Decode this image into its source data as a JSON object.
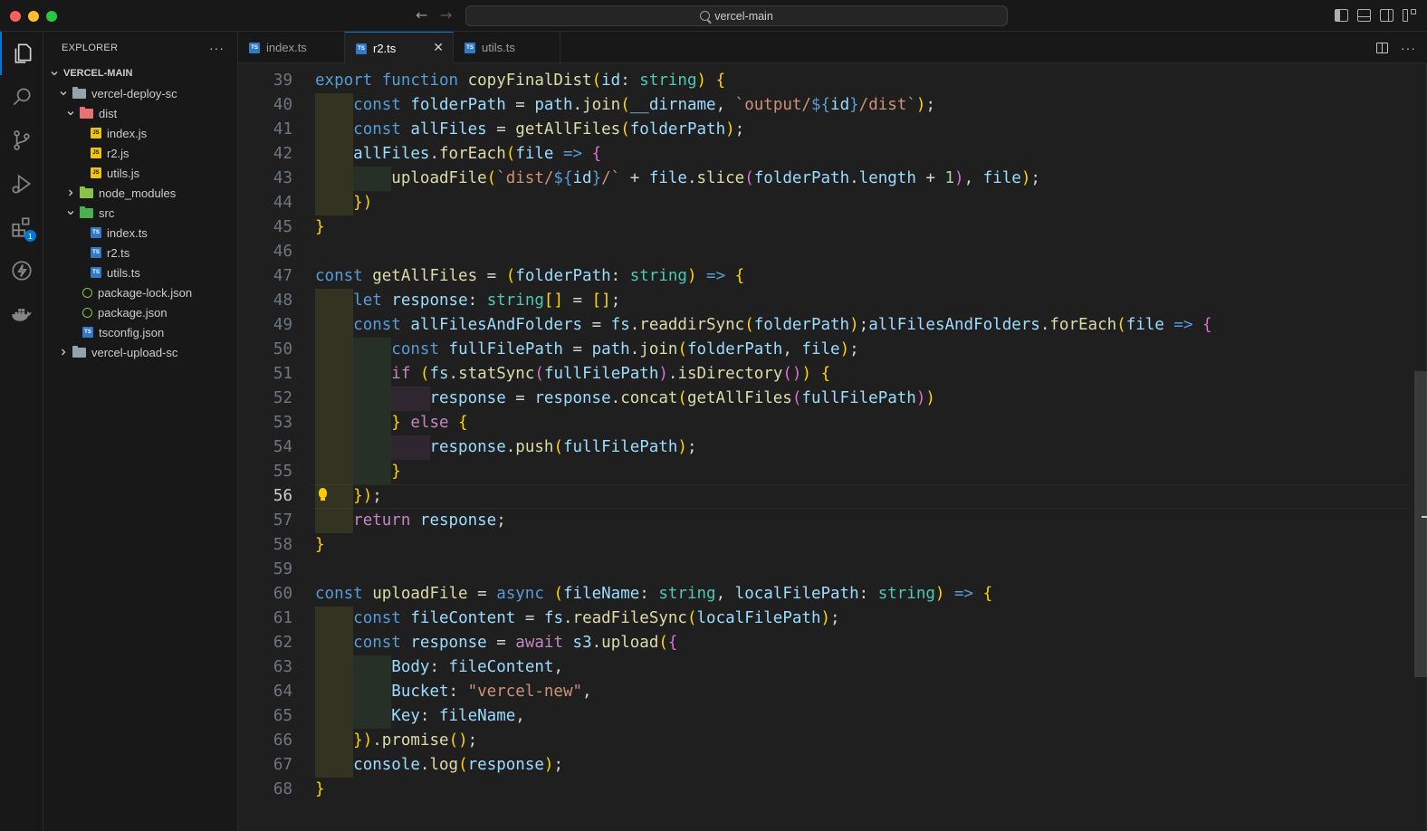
{
  "window": {
    "search_text": "vercel-main"
  },
  "sidebar": {
    "title": "EXPLORER",
    "more": "···",
    "root": "VERCEL-MAIN",
    "tree": [
      {
        "label": "vercel-deploy-sc",
        "kind": "folder-open",
        "icon": "folder-icon"
      },
      {
        "label": "dist",
        "kind": "folder-open",
        "icon": "folder-dist-icon"
      },
      {
        "label": "index.js",
        "kind": "file",
        "icon": "js-file-icon",
        "badge": "JS"
      },
      {
        "label": "r2.js",
        "kind": "file",
        "icon": "js-file-icon",
        "badge": "JS"
      },
      {
        "label": "utils.js",
        "kind": "file",
        "icon": "js-file-icon",
        "badge": "JS"
      },
      {
        "label": "node_modules",
        "kind": "folder-closed",
        "icon": "folder-node-icon"
      },
      {
        "label": "src",
        "kind": "folder-open",
        "icon": "folder-src-icon"
      },
      {
        "label": "index.ts",
        "kind": "file",
        "icon": "ts-file-icon",
        "badge": "TS"
      },
      {
        "label": "r2.ts",
        "kind": "file",
        "icon": "ts-file-icon",
        "badge": "TS"
      },
      {
        "label": "utils.ts",
        "kind": "file",
        "icon": "ts-file-icon",
        "badge": "TS"
      },
      {
        "label": "package-lock.json",
        "kind": "file",
        "icon": "json-file-icon",
        "badge": "{}"
      },
      {
        "label": "package.json",
        "kind": "file",
        "icon": "json-file-icon",
        "badge": "{}"
      },
      {
        "label": "tsconfig.json",
        "kind": "file",
        "icon": "tsconfig-file-icon",
        "badge": "TS"
      },
      {
        "label": "vercel-upload-sc",
        "kind": "folder-closed",
        "icon": "folder-icon"
      }
    ]
  },
  "activity": {
    "extensions_badge": "1"
  },
  "tabs": [
    {
      "label": "index.ts",
      "badge": "TS",
      "active": false
    },
    {
      "label": "r2.ts",
      "badge": "TS",
      "active": true,
      "close": "✕"
    },
    {
      "label": "utils.ts",
      "badge": "TS",
      "active": false
    }
  ],
  "editor": {
    "current_line": 56,
    "lines": [
      {
        "n": "39",
        "code": "export function copyFinalDist(id: string) {"
      },
      {
        "n": "40",
        "code": "    const folderPath = path.join(__dirname, `output/${id}/dist`);"
      },
      {
        "n": "41",
        "code": "    const allFiles = getAllFiles(folderPath);"
      },
      {
        "n": "42",
        "code": "    allFiles.forEach(file => {"
      },
      {
        "n": "43",
        "code": "        uploadFile(`dist/${id}/` + file.slice(folderPath.length + 1), file);"
      },
      {
        "n": "44",
        "code": "    })"
      },
      {
        "n": "45",
        "code": "}"
      },
      {
        "n": "46",
        "code": ""
      },
      {
        "n": "47",
        "code": "const getAllFiles = (folderPath: string) => {"
      },
      {
        "n": "48",
        "code": "    let response: string[] = [];"
      },
      {
        "n": "49",
        "code": "    const allFilesAndFolders = fs.readdirSync(folderPath);allFilesAndFolders.forEach(file => {"
      },
      {
        "n": "50",
        "code": "        const fullFilePath = path.join(folderPath, file);"
      },
      {
        "n": "51",
        "code": "        if (fs.statSync(fullFilePath).isDirectory()) {"
      },
      {
        "n": "52",
        "code": "            response = response.concat(getAllFiles(fullFilePath))"
      },
      {
        "n": "53",
        "code": "        } else {"
      },
      {
        "n": "54",
        "code": "            response.push(fullFilePath);"
      },
      {
        "n": "55",
        "code": "        }"
      },
      {
        "n": "56",
        "code": "    });"
      },
      {
        "n": "57",
        "code": "    return response;"
      },
      {
        "n": "58",
        "code": "}"
      },
      {
        "n": "59",
        "code": ""
      },
      {
        "n": "60",
        "code": "const uploadFile = async (fileName: string, localFilePath: string) => {"
      },
      {
        "n": "61",
        "code": "    const fileContent = fs.readFileSync(localFilePath);"
      },
      {
        "n": "62",
        "code": "    const response = await s3.upload({"
      },
      {
        "n": "63",
        "code": "        Body: fileContent,"
      },
      {
        "n": "64",
        "code": "        Bucket: \"vercel-new\","
      },
      {
        "n": "65",
        "code": "        Key: fileName,"
      },
      {
        "n": "66",
        "code": "    }).promise();"
      },
      {
        "n": "67",
        "code": "    console.log(response);"
      },
      {
        "n": "68",
        "code": "}"
      }
    ]
  },
  "colors": {
    "accent": "#0078d4",
    "background": "#1f1f1f",
    "sidebar_bg": "#181818",
    "keyword": "#569cd6",
    "function": "#dcdcaa",
    "string": "#ce9178"
  }
}
